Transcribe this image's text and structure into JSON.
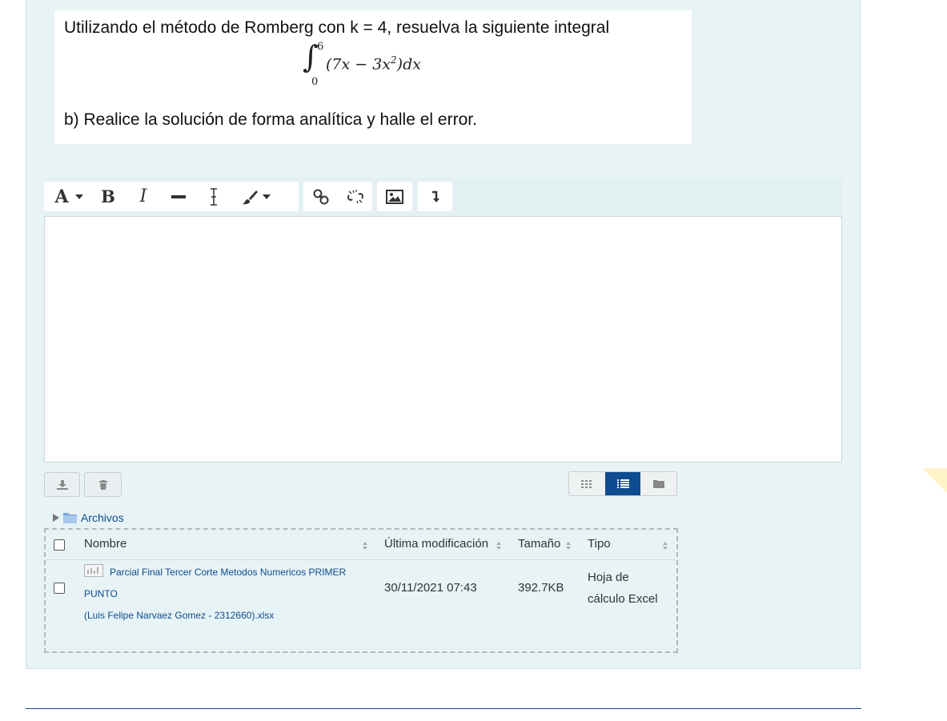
{
  "question": {
    "line1": "Utilizando el método de Romberg con k = 4, resuelva la siguiente integral",
    "integral": {
      "upper": "6",
      "lower": "0",
      "integrand": "(7x − 3x",
      "exp": "2",
      "tail": ")dx"
    },
    "line2": "b) Realice la solución de forma analítica y halle el error."
  },
  "toolbar": {
    "icons": [
      "font-size-icon",
      "bold-icon",
      "italic-icon",
      "strikethrough-icon",
      "clear-format-icon",
      "paint-brush-icon",
      "link-icon",
      "unlink-icon",
      "image-icon",
      "insert-below-icon"
    ],
    "labels": {
      "font": "A",
      "bold": "B",
      "italic": "I"
    }
  },
  "filemanager": {
    "breadcrumb": "Archivos",
    "columns": [
      "Nombre",
      "Última modificación",
      "Tamaño",
      "Tipo"
    ],
    "rows": [
      {
        "name_line1": "Parcial Final Tercer Corte Metodos Numericos PRIMER PUNTO",
        "name_line2": "(Luis Felipe Narvaez Gomez - 2312660).xlsx",
        "modified": "30/11/2021 07:43",
        "size": "392.7KB",
        "type_line1": "Hoja de",
        "type_line2": "cálculo Excel"
      }
    ],
    "view_modes": [
      "icon-view",
      "list-view",
      "tree-view"
    ],
    "active_view": "list-view"
  },
  "colors": {
    "accent": "#0f4b8f",
    "panel": "#e7f3f5",
    "highlight_corner": "#fff3c8"
  }
}
